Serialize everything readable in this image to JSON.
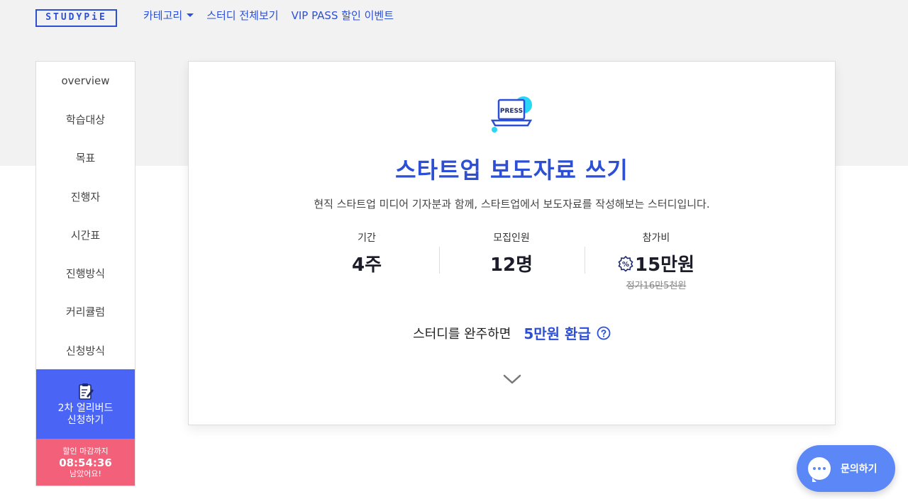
{
  "header": {
    "logo_text": "STUDYPiE",
    "nav": [
      {
        "label": "카테고리",
        "has_dropdown": true
      },
      {
        "label": "스터디 전체보기"
      },
      {
        "label": "VIP PASS 할인 이벤트"
      }
    ]
  },
  "sidebar": {
    "items": [
      {
        "label": "overview"
      },
      {
        "label": "학습대상"
      },
      {
        "label": "목표"
      },
      {
        "label": "진행자"
      },
      {
        "label": "시간표"
      },
      {
        "label": "진행방식"
      },
      {
        "label": "커리큘럼"
      },
      {
        "label": "신청방식"
      }
    ],
    "apply": {
      "line1": "2차 얼리버드",
      "line2": "신청하기"
    },
    "deadline": {
      "label": "할인 마감까지",
      "time": "08:54:36",
      "remain": "남았어요!"
    }
  },
  "card": {
    "icon_text": "PRESS",
    "title": "스타트업 보도자료 쓰기",
    "description": "현직 스타트업 미디어 기자분과 함께, 스타트업에서 보도자료를 작성해보는 스터디입니다.",
    "stats": {
      "period": {
        "label": "기간",
        "value": "4주"
      },
      "capacity": {
        "label": "모집인원",
        "value": "12명"
      },
      "fee": {
        "label": "참가비",
        "value": "15만원",
        "original": "정가16만5천원",
        "badge": "%"
      }
    },
    "refund": {
      "text": "스터디를 완주하면",
      "amount": "5만원 환급"
    }
  },
  "chat": {
    "label": "문의하기"
  },
  "colors": {
    "accent": "#2c4fd6",
    "apply_bg": "#4a65f5",
    "deadline_bg": "#f2607a",
    "chat_bg": "#5b88f6",
    "band_bg": "#f2f2f2"
  }
}
